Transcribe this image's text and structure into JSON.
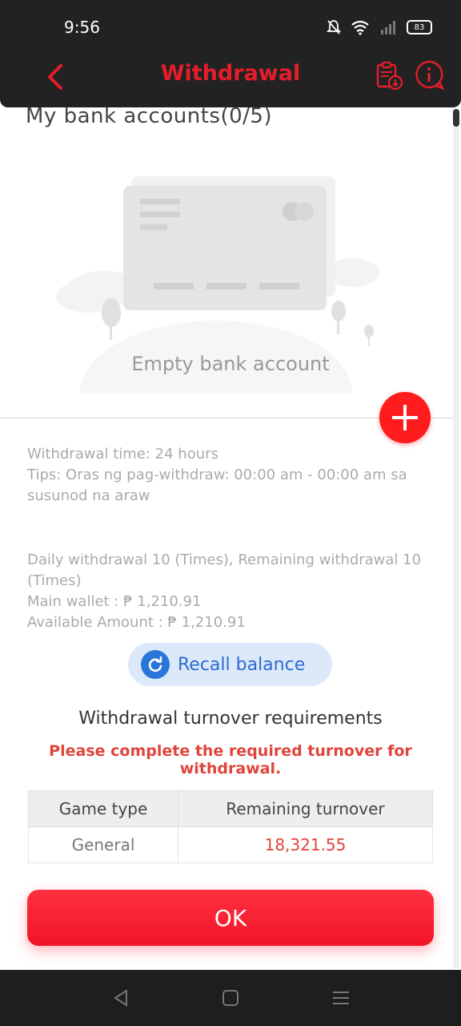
{
  "status": {
    "time": "9:56",
    "battery": "83"
  },
  "header": {
    "title": "Withdrawal"
  },
  "bank": {
    "section_title": "My bank accounts(0/5)",
    "empty_text": "Empty bank account"
  },
  "info": {
    "withdrawal_time": "Withdrawal time:   24 hours",
    "tips": "Tips:  Oras ng pag-withdraw: 00:00 am - 00:00 am sa susunod na araw",
    "daily": "Daily withdrawal 10 (Times), Remaining withdrawal 10 (Times)",
    "main_wallet": "Main wallet : ₱ 1,210.91",
    "available": "Available Amount : ₱ 1,210.91"
  },
  "recall": {
    "label": "Recall balance"
  },
  "requirements": {
    "title": "Withdrawal turnover requirements",
    "warning": "Please complete the required turnover for withdrawal.",
    "headers": [
      "Game type",
      "Remaining turnover"
    ],
    "rows": [
      {
        "game_type": "General",
        "remaining": "18,321.55"
      }
    ]
  },
  "ok_label": "OK",
  "colors": {
    "accent": "#e51d2b",
    "button": "#ff1c1c",
    "link": "#2f6ad0"
  }
}
